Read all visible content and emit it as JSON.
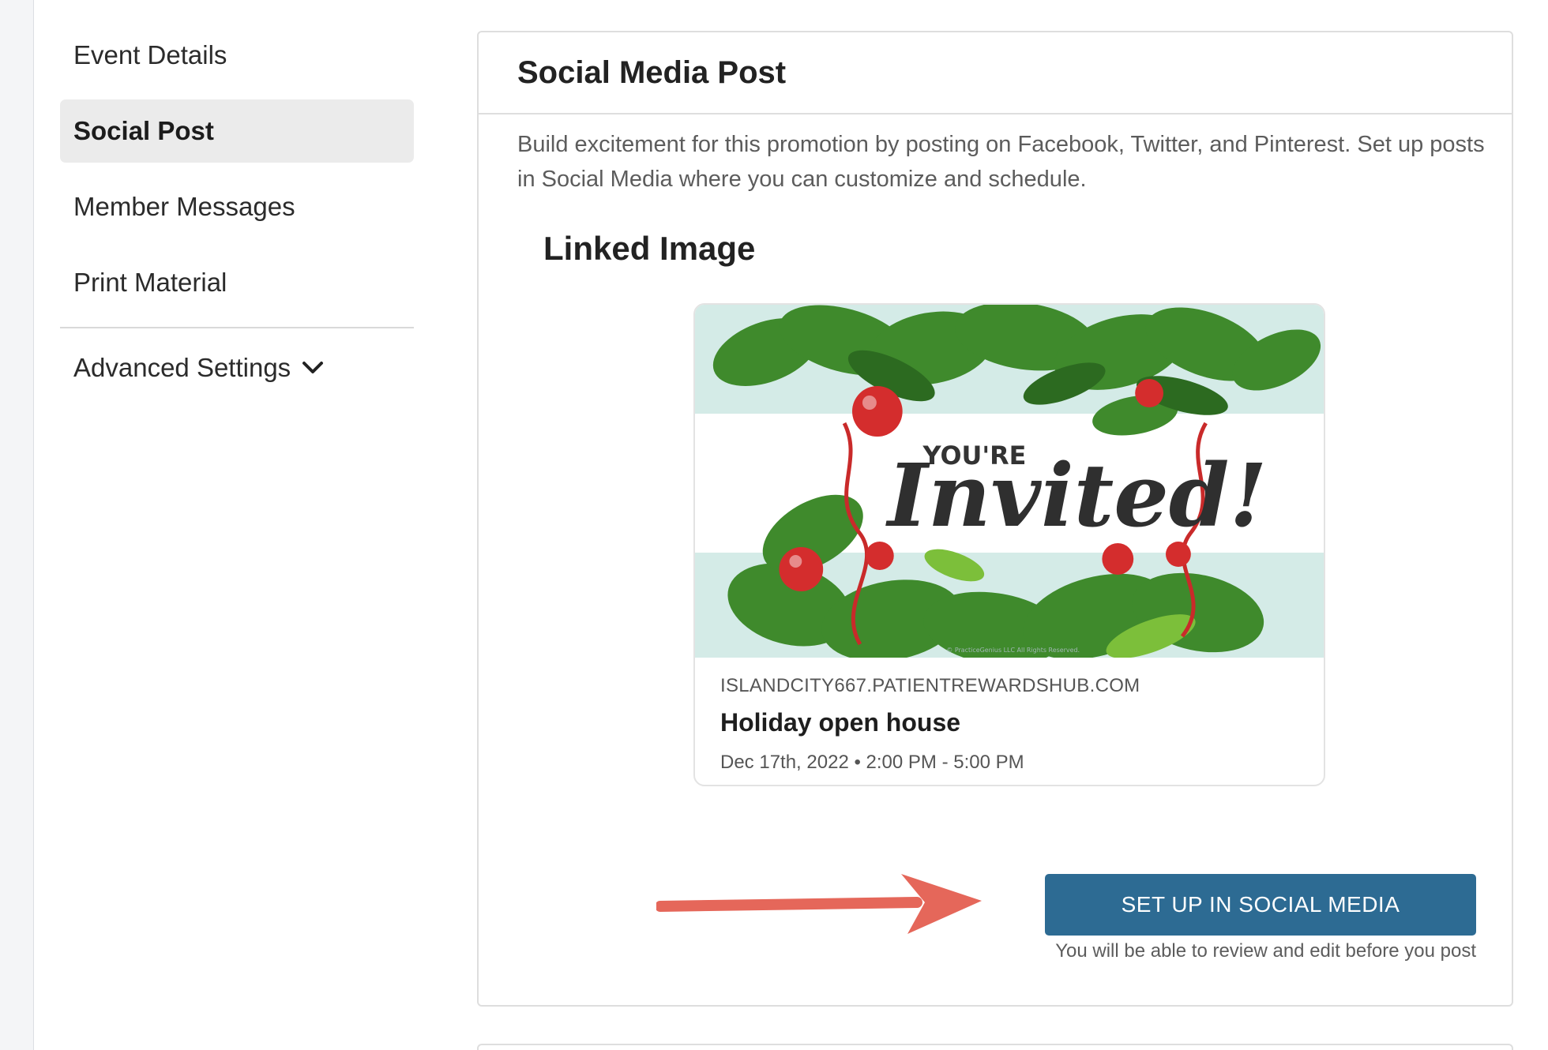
{
  "sidebar": {
    "items": [
      {
        "label": "Event Details",
        "active": false
      },
      {
        "label": "Social Post",
        "active": true
      },
      {
        "label": "Member Messages",
        "active": false
      },
      {
        "label": "Print Material",
        "active": false
      }
    ],
    "advanced": {
      "label": "Advanced Settings",
      "icon": "chevron-down-icon"
    }
  },
  "card": {
    "title": "Social Media Post",
    "description": "Build excitement for this promotion by posting on Facebook, Twitter, and Pinterest. Set up posts in Social Media where you can customize and schedule.",
    "section_title": "Linked Image",
    "preview": {
      "image_text_small": "YOU'RE",
      "image_text_large": "Invited!",
      "image_credit": "© PracticeGenius LLC All Rights Reserved.",
      "domain": "ISLANDCITY667.PATIENTREWARDSHUB.COM",
      "title": "Holiday open house",
      "date": "Dec 17th, 2022 • 2:00 PM - 5:00 PM"
    },
    "cta": {
      "label": "SET UP IN SOCIAL MEDIA",
      "hint": "You will be able to review and edit before you post"
    }
  },
  "colors": {
    "accent": "#2d6b93",
    "active_nav_bg": "#ebebeb",
    "arrow": "#e5675a",
    "image_bg": "#d4ebe7",
    "holly_green": "#3f8a2c",
    "berry_red": "#d42d2d"
  }
}
